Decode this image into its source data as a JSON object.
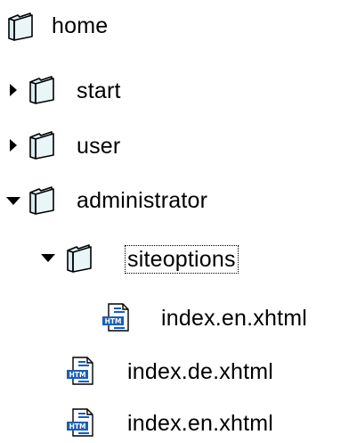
{
  "tree": {
    "home": {
      "label": "home",
      "icon": "folder-icon"
    },
    "start": {
      "label": "start",
      "icon": "folder-icon",
      "expanded": false
    },
    "user": {
      "label": "user",
      "icon": "folder-icon",
      "expanded": false
    },
    "administrator": {
      "label": "administrator",
      "icon": "folder-icon",
      "expanded": true
    },
    "siteoptions": {
      "label": "siteoptions",
      "icon": "folder-icon",
      "expanded": true,
      "selected": true
    },
    "siteoptions_index_en": {
      "label": "index.en.xhtml",
      "icon": "htm-file-icon"
    },
    "index_de": {
      "label": "index.de.xhtml",
      "icon": "htm-file-icon"
    },
    "index_en": {
      "label": "index.en.xhtml",
      "icon": "htm-file-icon"
    }
  },
  "colors": {
    "folder_fill": "#d9ecf2",
    "folder_stroke": "#000000",
    "file_accent": "#1a5fb4"
  }
}
